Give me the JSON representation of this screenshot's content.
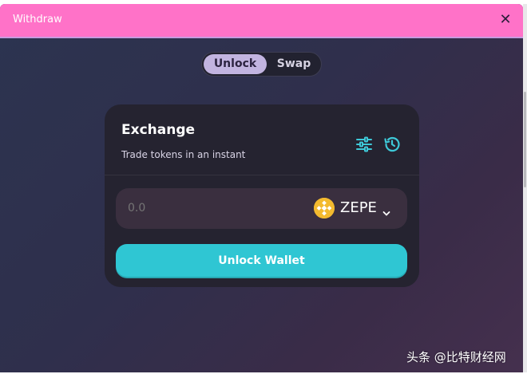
{
  "window": {
    "title": "Withdraw"
  },
  "toggle": {
    "tabs": [
      {
        "label": "Unlock",
        "active": true
      },
      {
        "label": "Swap",
        "active": false
      }
    ]
  },
  "card": {
    "title": "Exchange",
    "subtitle": "Trade tokens in an instant",
    "icons": [
      "settings-sliders-icon",
      "history-icon"
    ],
    "input": {
      "value": "",
      "placeholder": "0.0"
    },
    "token": {
      "symbol": "ZEPE",
      "logo": "bnb-logo-icon"
    },
    "primary_button": "Unlock Wallet"
  },
  "watermark": "头条 @比特财经网",
  "colors": {
    "titlebar": "#ff72c8",
    "accent": "#2fc6d3",
    "active_tab": "#c2b4e0",
    "card_bg": "#252330",
    "token_logo": "#f3ba2f"
  }
}
